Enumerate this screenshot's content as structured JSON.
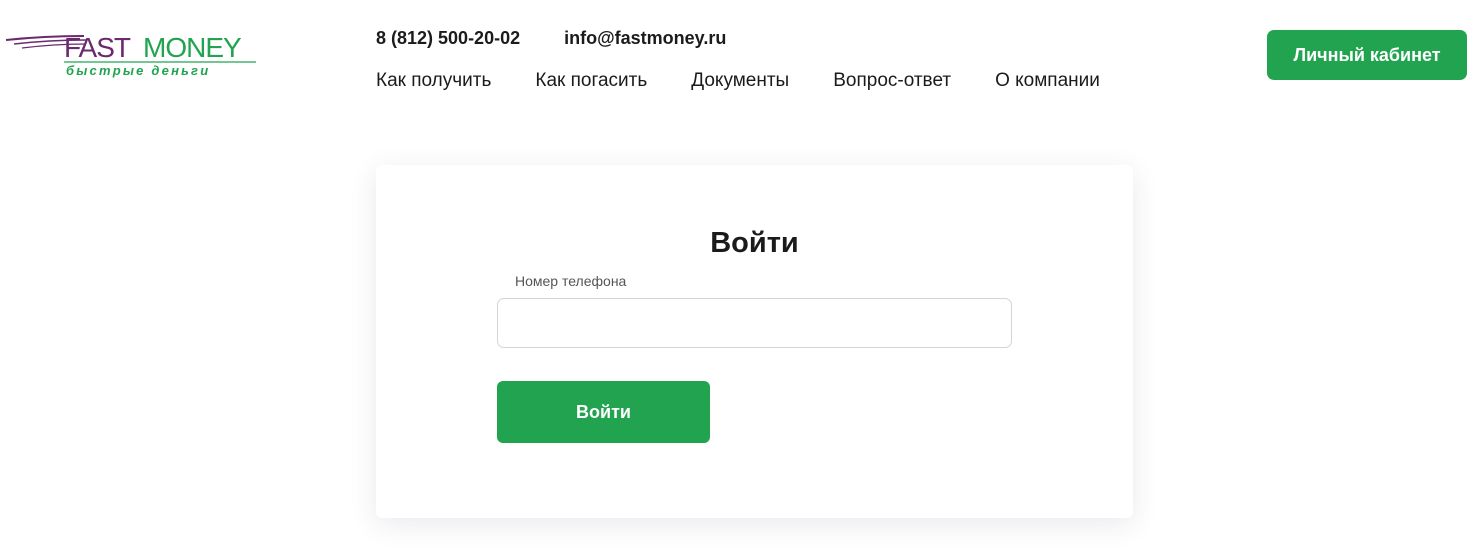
{
  "header": {
    "logo": {
      "brand_part1": "FAST",
      "brand_part2": "MONEY",
      "tagline": "быстрые деньги",
      "colors": {
        "purple": "#6b2a6e",
        "green": "#22a350"
      }
    },
    "phone": "8 (812) 500-20-02",
    "email": "info@fastmoney.ru",
    "nav": [
      {
        "label": "Как получить"
      },
      {
        "label": "Как погасить"
      },
      {
        "label": "Документы"
      },
      {
        "label": "Вопрос-ответ"
      },
      {
        "label": "О компании"
      }
    ],
    "cabinet_button": "Личный кабинет"
  },
  "login_card": {
    "title": "Войти",
    "phone_label": "Номер телефона",
    "phone_value": "",
    "phone_placeholder": "",
    "submit_label": "Войти"
  },
  "colors": {
    "accent": "#22a350",
    "text": "#1b1b1b"
  }
}
